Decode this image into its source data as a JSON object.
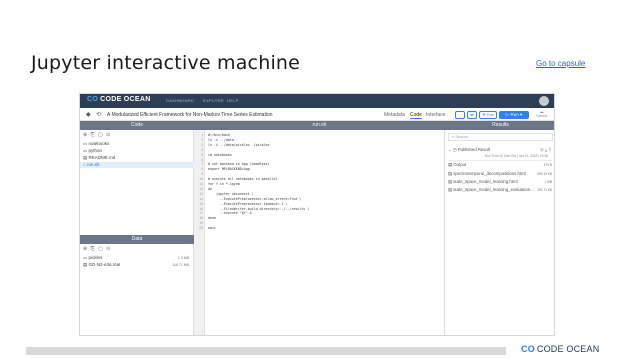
{
  "slide": {
    "title": "Jupyter interactive machine",
    "link": "Go to capsule"
  },
  "app": {
    "brand_mark": "CO",
    "brand_name": "CODE OCEAN",
    "nav": [
      "DASHBOARD",
      "EXPLORE",
      "HELP"
    ],
    "capsule_title": "A Modularized Efficient Framework for Non-Markov Time Series Estimation",
    "tabs": {
      "metadata": "Metadata",
      "code": "Code",
      "interface": "Interface"
    },
    "env_label": "Env",
    "run_label": "Run",
    "saved_label": "Saved"
  },
  "code_panel": {
    "title": "Code",
    "files": [
      "notebooks",
      "python",
      "README.md",
      "run.sh"
    ]
  },
  "data_panel": {
    "title": "Data",
    "files": [
      {
        "name": "pickles",
        "size": "1.9 MB"
      },
      {
        "name": "GD-N2-e3a.mat",
        "size": "116.71 MB"
      }
    ]
  },
  "editor": {
    "filename": "run.sh",
    "lines": [
      "#!/bin/bash",
      "ln -s ../data",
      "ln -s ../data/pickles ./pickles",
      "",
      "cd notebooks",
      "",
      "# set backend to Agg (headless)",
      "export MPLBACKEND=Agg",
      "",
      "# execute all notebooks in parallel",
      "for f in *.ipynb",
      "do",
      "    jupyter nbconvert \\",
      "      --ExecutePreprocessor.allow_errors=True \\",
      "      --ExecutePreprocessor.timeout=-1 \\",
      "      --FilesWriter.build_directory=../../results \\",
      "      --execute \"$f\" &",
      "done",
      "",
      "wait"
    ]
  },
  "results": {
    "title": "Results",
    "search_placeholder": "Search",
    "published": "Published Result",
    "run_time": "Run Time 2h 02m 09s | Jan 16, 2018 | 19:48",
    "output": {
      "name": "Output",
      "size": "479 B"
    },
    "files": [
      {
        "name": "spectrotemporal_decompositions.html",
        "size": "509.19 KB"
      },
      {
        "name": "state_space_model_learning.html",
        "size": "1 MB"
      },
      {
        "name": "state_space_model_learning_evaluation...",
        "size": "393.71 KB"
      }
    ]
  },
  "footer": {
    "mark": "CO",
    "name": "CODE OCEAN"
  },
  "colors": {
    "navbar": "#2f3e57",
    "accent": "#2d7ff9",
    "panel_header": "#6b7686",
    "link": "#1a6fc4"
  }
}
